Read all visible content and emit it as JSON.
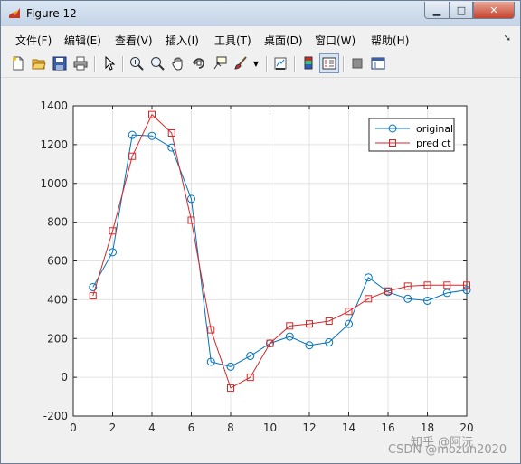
{
  "window": {
    "title": "Figure 12"
  },
  "menu": [
    {
      "label": "文件(F)"
    },
    {
      "label": "编辑(E)"
    },
    {
      "label": "查看(V)"
    },
    {
      "label": "插入(I)"
    },
    {
      "label": "工具(T)"
    },
    {
      "label": "桌面(D)"
    },
    {
      "label": "窗口(W)"
    },
    {
      "label": "帮助(H)"
    }
  ],
  "toolbar": [
    {
      "icon": "new-figure-icon"
    },
    {
      "icon": "open-folder-icon"
    },
    {
      "icon": "save-icon"
    },
    {
      "icon": "print-icon"
    },
    {
      "icon": "pointer-icon"
    },
    {
      "icon": "zoom-in-icon"
    },
    {
      "icon": "zoom-out-icon"
    },
    {
      "icon": "pan-hand-icon"
    },
    {
      "icon": "rotate-3d-icon"
    },
    {
      "icon": "data-cursor-icon"
    },
    {
      "icon": "brush-icon"
    },
    {
      "icon": "link-plot-icon"
    },
    {
      "icon": "colorbar-icon"
    },
    {
      "icon": "legend-icon"
    },
    {
      "icon": "hide-plot-tools-icon"
    },
    {
      "icon": "show-plot-tools-icon"
    }
  ],
  "chart_data": {
    "type": "line",
    "x": [
      1,
      2,
      3,
      4,
      5,
      6,
      7,
      8,
      9,
      10,
      11,
      12,
      13,
      14,
      15,
      16,
      17,
      18,
      19,
      20
    ],
    "series": [
      {
        "name": "original",
        "color": "#0072bd",
        "marker": "circle",
        "values": [
          465,
          645,
          1250,
          1245,
          1185,
          920,
          80,
          55,
          110,
          175,
          210,
          165,
          180,
          275,
          515,
          440,
          405,
          395,
          435,
          450
        ]
      },
      {
        "name": "predict",
        "color": "#d62728",
        "marker": "square",
        "values": [
          420,
          755,
          1140,
          1355,
          1260,
          810,
          245,
          -55,
          0,
          175,
          265,
          275,
          290,
          340,
          405,
          445,
          470,
          475,
          475,
          475
        ]
      }
    ],
    "xlim": [
      0,
      20
    ],
    "ylim": [
      -200,
      1400
    ],
    "xticks": [
      "0",
      "2",
      "4",
      "6",
      "8",
      "10",
      "12",
      "14",
      "16",
      "18",
      "20"
    ],
    "yticks": [
      "-200",
      "0",
      "200",
      "400",
      "600",
      "800",
      "1000",
      "1200",
      "1400"
    ],
    "grid": true,
    "legend": "top-right"
  },
  "watermarks": {
    "zhihu": "知乎 @阿沅",
    "csdn": "CSDN @mozun2020"
  }
}
